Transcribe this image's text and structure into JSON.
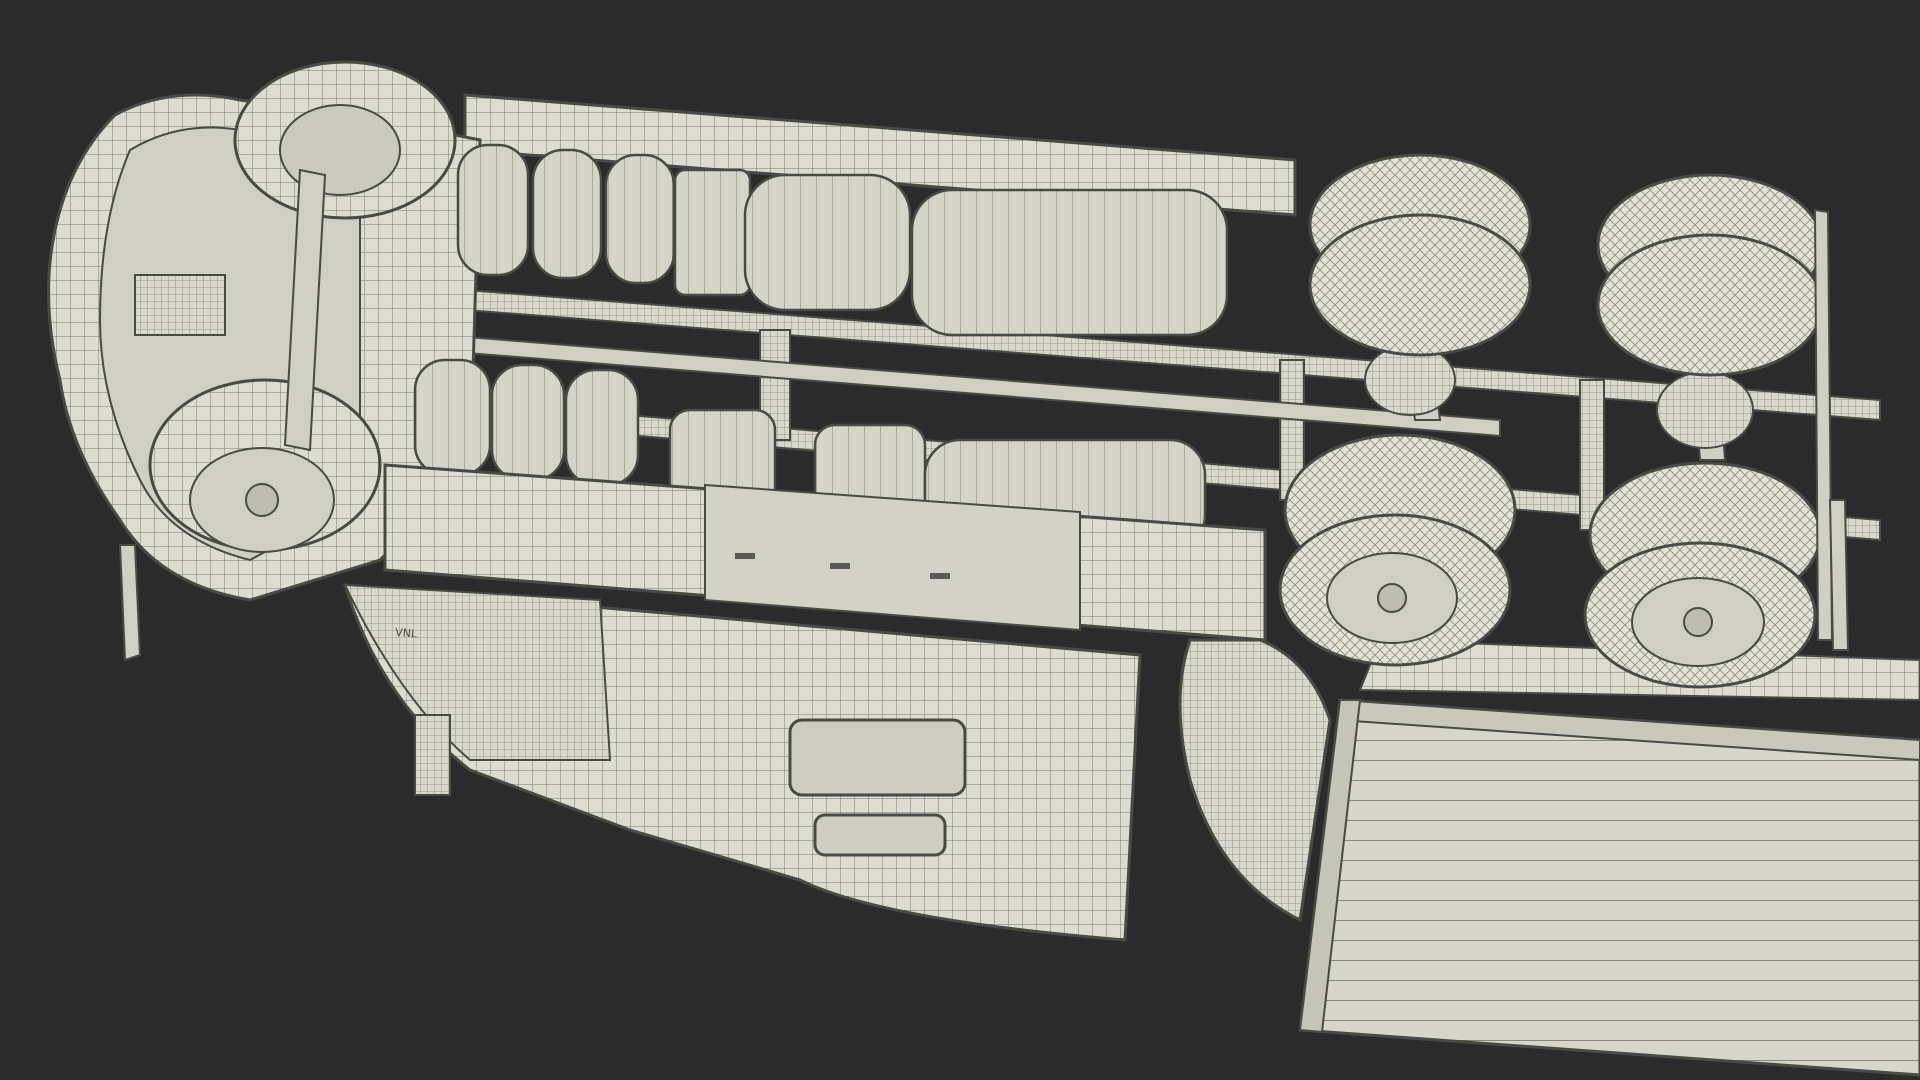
{
  "scene": {
    "background_color": "#2b2b2b",
    "model_fill": "#dcdcd0",
    "wire_color": "#6e6e68",
    "shadow_fill": "#c3c3b6",
    "badge_text": "VNL"
  }
}
